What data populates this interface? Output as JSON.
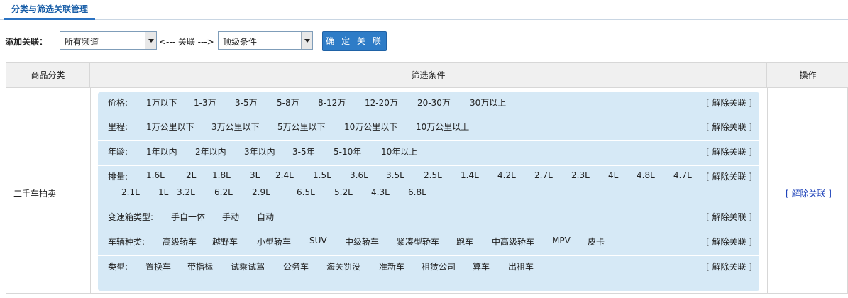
{
  "tab": {
    "title": "分类与筛选关联管理"
  },
  "add": {
    "label": "添加关联：",
    "channel_value": "所有频道",
    "link_text": "<--- 关联 --->",
    "condition_value": "顶级条件",
    "confirm_label": "确 定 关 联"
  },
  "table": {
    "headers": [
      "商品分类",
      "筛选条件",
      "操作"
    ],
    "category": "二手车拍卖",
    "row_unlink": "[ 解除关联 ]",
    "filters": [
      {
        "label": "价格:",
        "unlink": "[ 解除关联 ]",
        "options": [
          "1万以下",
          "1-3万",
          "3-5万",
          "5-8万",
          "8-12万",
          "12-20万",
          "20-30万",
          "30万以上"
        ]
      },
      {
        "label": "里程:",
        "unlink": "[ 解除关联 ]",
        "options": [
          "1万公里以下",
          "3万公里以下",
          "5万公里以下",
          "10万公里以下",
          "10万公里以上"
        ]
      },
      {
        "label": "年龄:",
        "unlink": "[ 解除关联 ]",
        "options": [
          "1年以内",
          "2年以内",
          "3年以内",
          "3-5年",
          "5-10年",
          "10年以上"
        ]
      },
      {
        "label": "排量:",
        "unlink": "[ 解除关联 ]",
        "options": [
          "1.6L",
          "2L",
          "1.8L",
          "3L",
          "2.4L",
          "1.5L",
          "3.6L",
          "3.5L",
          "2.5L",
          "1.4L",
          "4.2L",
          "2.7L",
          "2.3L",
          "4L",
          "4.8L",
          "4.7L",
          "2.1L",
          "1L",
          "3.2L",
          "6.2L",
          "2.9L",
          "6.5L",
          "5.2L",
          "4.3L",
          "6.8L"
        ]
      },
      {
        "label": "变速箱类型:",
        "unlink": "[ 解除关联 ]",
        "options": [
          "手自一体",
          "手动",
          "自动"
        ]
      },
      {
        "label": "车辆种类:",
        "unlink": "[ 解除关联 ]",
        "options": [
          "高级轿车",
          "越野车",
          "小型轿车",
          "SUV",
          "中级轿车",
          "紧凑型轿车",
          "跑车",
          "中高级轿车",
          "MPV",
          "皮卡"
        ]
      },
      {
        "label": "类型:",
        "unlink": "[ 解除关联 ]",
        "options": [
          "置换车",
          "带指标",
          "试乘试驾",
          "公务车",
          "海关罚没",
          "准新车",
          "租赁公司",
          "算车",
          "出租车"
        ]
      }
    ]
  }
}
